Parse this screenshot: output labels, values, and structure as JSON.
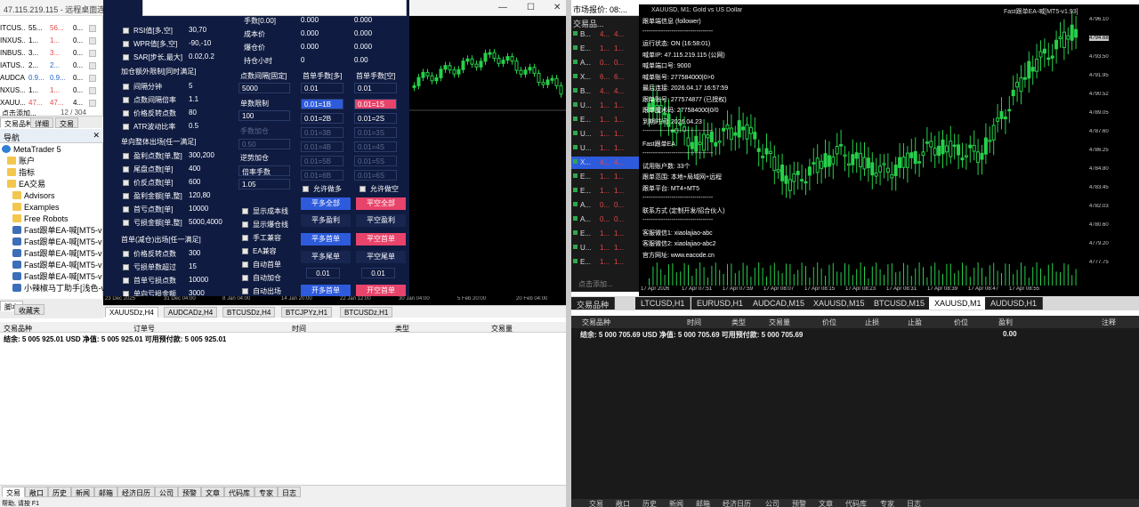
{
  "left_window": {
    "title": "47.115.219.115 - 远程桌面连接",
    "win_controls": [
      "—",
      "☐",
      "✕"
    ]
  },
  "market_watch": {
    "rows": [
      {
        "symbol": "ITCUS...",
        "bid": "55...",
        "ask": "56...",
        "delta": "0..."
      },
      {
        "symbol": "INXUS...",
        "bid": "1...",
        "ask": "1...",
        "delta": "0..."
      },
      {
        "symbol": "INBUS...",
        "bid": "3...",
        "ask": "3...",
        "delta": "0..."
      },
      {
        "symbol": "IATUS...",
        "bid": "2...",
        "ask": "2...",
        "delta": "0..."
      },
      {
        "symbol": "AUDCA...",
        "bid": "0.9...",
        "ask": "0.9...",
        "delta": "0..."
      },
      {
        "symbol": "NXUS...",
        "bid": "1...",
        "ask": "1...",
        "delta": "0..."
      },
      {
        "symbol": "XAUU...",
        "bid": "47...",
        "ask": "47...",
        "delta": "4..."
      }
    ],
    "footer": "点击添加...",
    "count": "12 / 304",
    "tabs": [
      "交易品种",
      "详细",
      "交易"
    ]
  },
  "navigator": {
    "header": "导航",
    "root": "MetaTrader 5",
    "items": [
      "账户",
      "指标",
      "EA交易",
      "Advisors",
      "Examples",
      "Free Robots",
      "Fast跟单EA-喊[MT5-v",
      "Fast跟单EA-喊[MT5-v",
      "Fast跟单EA-喊[MT5-v",
      "Fast跟单EA-喊[MT5-v",
      "Fast跟单EA-喊[MT5-v",
      "小辣椒马丁助手[浅色-v"
    ],
    "tabs": [
      "脚本",
      "收藏夹"
    ]
  },
  "ea_panel": {
    "top_rows": [
      {
        "label": "RSI值[多,空]",
        "value": "30,70"
      },
      {
        "label": "WPR值[多,空]",
        "value": "-90,-10"
      },
      {
        "label": "SAR[步长,最大]",
        "value": "0.02,0.2"
      }
    ],
    "section1": "加仓额外限制[同时满足]",
    "sec1_rows": [
      {
        "label": "间隔分钟",
        "value": "5"
      },
      {
        "label": "点数间隔倍率",
        "value": "1.1"
      },
      {
        "label": "价格反转点数",
        "value": "80"
      },
      {
        "label": "ATR波动比率",
        "value": "0.5"
      }
    ],
    "section2": "单向整体出场[任一满足]",
    "sec2_rows": [
      {
        "label": "盈利点数[单,整]",
        "value": "300,200"
      },
      {
        "label": "尾盘点数[单]",
        "value": "400"
      },
      {
        "label": "价反点数[单]",
        "value": "600"
      },
      {
        "label": "盈利金额[单,整]",
        "value": "120,80"
      },
      {
        "label": "首亏点数[单]",
        "value": "10000"
      },
      {
        "label": "亏损金额[单,整]",
        "value": "5000,4000"
      }
    ],
    "section3": "首单(减仓)出场[任一满足]",
    "sec3_rows": [
      {
        "label": "价格反转点数",
        "value": "300"
      },
      {
        "label": "亏损单数超过",
        "value": "15"
      },
      {
        "label": "首单亏损点数",
        "value": "10000"
      },
      {
        "label": "单向亏损金额",
        "value": "3000"
      }
    ],
    "mid_labels": [
      "手数[0.00]",
      "成本价",
      "爆仓价",
      "持仓小时"
    ],
    "mid_vals_a": [
      "0.000",
      "0.000",
      "0.000",
      "0"
    ],
    "mid_vals_b": [
      "0.000",
      "0.000",
      "0.000",
      "0.00"
    ],
    "interval_label": "点数间隔[固定]",
    "interval_value": "5000",
    "limit_label": "单数限制",
    "limit_value": "100",
    "lot_buy_label": "首单手数[多]",
    "lot_sell_label": "首单手数[空]",
    "lot_buy_value": "0.01",
    "lot_sell_value": "0.01",
    "buy_chain": [
      "0.01=1B",
      "0.01=2B",
      "0.01=3B",
      "0.01=4B",
      "0.01=5B",
      "0.01=6B"
    ],
    "sell_chain": [
      "0.01=1S",
      "0.01=2S",
      "0.01=3S",
      "0.01=4S",
      "0.01=5S",
      "0.01=6S"
    ],
    "mid_left_opts": [
      "手数加仓",
      "0.50",
      "逆势加仓",
      "倍率手数",
      "1.05"
    ],
    "allow_buy": "允许做多",
    "allow_sell": "允许做空",
    "checks": [
      "显示成本线",
      "显示爆仓线",
      "手工兼容",
      "EA兼容",
      "自动首单",
      "自动加仓",
      "自动出场"
    ],
    "buttons": {
      "close_all_buy": "平多全部",
      "close_all_sell": "平空全部",
      "close_buy_profit": "平多盈利",
      "close_sell_profit": "平空盈利",
      "close_buy_first": "平多首单",
      "close_sell_first": "平空首单",
      "close_buy_tail": "平多尾单",
      "close_sell_tail": "平空尾单",
      "open_buy": "开多首单",
      "open_sell": "开空首单"
    },
    "small_lots": [
      "0.01",
      "0.01"
    ]
  },
  "left_chart_axis": [
    "23 Dec 2025",
    "31 Dec 04:00",
    "8 Jan 04:00",
    "14 Jan 20:00",
    "22 Jan 12:00",
    "30 Jan 04:00",
    "5 Feb 20:00",
    "20 Feb 04:00"
  ],
  "left_chart_tabs": [
    "XAUUSDz,H4",
    "AUDCADz,H4",
    "BTCUSDz,H4",
    "BTCJPYz,H1",
    "BTCUSDz,H1"
  ],
  "left_terminal": {
    "headers": [
      "交易品种",
      "订单号",
      "时间",
      "类型",
      "交易量"
    ],
    "balance": "结余: 5 005 925.01 USD  净值: 5 005 925.01  可用预付款: 5 005 925.01",
    "tabs": [
      "交易",
      "敞口",
      "历史",
      "新闻",
      "邮箱",
      "经济日历",
      "公司",
      "预警",
      "文章",
      "代码库",
      "专家",
      "日志"
    ],
    "status": "帮助, 请按 F1"
  },
  "right_window": {
    "title": "市场报价: 08:...",
    "mw_header": "交易品...",
    "mw_rows": [
      {
        "symbol": "B...",
        "bid": "4...",
        "ask": "4..."
      },
      {
        "symbol": "E...",
        "bid": "1...",
        "ask": "1..."
      },
      {
        "symbol": "A...",
        "bid": "0...",
        "ask": "0..."
      },
      {
        "symbol": "X...",
        "bid": "6...",
        "ask": "6..."
      },
      {
        "symbol": "B...",
        "bid": "4...",
        "ask": "4..."
      },
      {
        "symbol": "U...",
        "bid": "1...",
        "ask": "1..."
      },
      {
        "symbol": "E...",
        "bid": "1...",
        "ask": "1..."
      },
      {
        "symbol": "U...",
        "bid": "1...",
        "ask": "1..."
      },
      {
        "symbol": "U...",
        "bid": "1...",
        "ask": "1..."
      },
      {
        "symbol": "X...",
        "bid": "4...",
        "ask": "4..."
      },
      {
        "symbol": "E...",
        "bid": "1...",
        "ask": "1..."
      },
      {
        "symbol": "E...",
        "bid": "1...",
        "ask": "1..."
      },
      {
        "symbol": "A...",
        "bid": "0...",
        "ask": "0..."
      },
      {
        "symbol": "A...",
        "bid": "0...",
        "ask": "0..."
      },
      {
        "symbol": "E...",
        "bid": "1...",
        "ask": "1..."
      },
      {
        "symbol": "U...",
        "bid": "1...",
        "ask": "1..."
      },
      {
        "symbol": "E...",
        "bid": "1...",
        "ask": "1..."
      }
    ],
    "mw_footer": "点击添加...",
    "mw_tab": "交易品种"
  },
  "right_chart": {
    "symbol_line": "XAUUSD, M1:  Gold vs US Dollar",
    "ea_badge": "Fast跟单EA-喊[MT5-v1.93]",
    "overlay": [
      "跟单端信息 (follower)",
      "----------------------------------",
      "运行状态:   ON  (16:58:01)",
      "喊单IP:   47.115.219.115 (公网)",
      "喊单端口号:   9000",
      "喊单账号:   277584000|0>0",
      "最后连接:   2026.04.17 16:57:59",
      "跟单账号:   277574877 (已授权)",
      "跟单魔术码:   277584000|0/0",
      "到期时间:   2026.04.23",
      "----------------------------------",
      "Fast跟单EA",
      "----------------------------------",
      "试用账户数:   33个",
      "跟单范围:  本地+局域网+远程",
      "跟单平台:   MT4+MT5",
      "----------------------------------",
      "联系方式   (定制开发/招合伙人)",
      "----------------------------------",
      "客服微信1:   xiaolajiao-abc",
      "客服微信2:   xiaolajiao-abc2",
      "官方网址:   www.eacode.cn"
    ],
    "price_labels": [
      "4796.10",
      "4794.68",
      "4793.50",
      "4791.95",
      "4790.52",
      "4789.05",
      "4787.60",
      "4786.25",
      "4784.80",
      "4783.45",
      "4782.03",
      "4780.60",
      "4779.20",
      "4777.75"
    ],
    "time_labels": [
      "17 Apr 2026",
      "17 Apr 07:51",
      "17 Apr 07:59",
      "17 Apr 08:07",
      "17 Apr 08:15",
      "17 Apr 08:23",
      "17 Apr 08:31",
      "17 Apr 08:39",
      "17 Apr 08:47",
      "17 Apr 08:55"
    ],
    "tabs": [
      "LTCUSD,H1",
      "EURUSD,H1",
      "AUDCAD,M15",
      "XAUUSD,M15",
      "BTCUSD,M15",
      "XAUUSD,M1",
      "AUDUSD,H1"
    ],
    "left_tab": "交易品种"
  },
  "right_terminal": {
    "headers": [
      "交易品种",
      "时间",
      "类型",
      "交易量",
      "价位",
      "止损",
      "止盈",
      "价位",
      "盈利",
      "注释"
    ],
    "balance": "结余: 5 000 705.69 USD  净值: 5 000 705.69  可用预付款: 5 000 705.69",
    "profit": "0.00",
    "tabs": [
      "交易",
      "敞口",
      "历史",
      "新闻",
      "邮箱",
      "经济日历",
      "公司",
      "预警",
      "文章",
      "代码库",
      "专家",
      "日志"
    ]
  },
  "colors": {
    "panel_bg": "#0f1b40",
    "btn_blue": "#2e5bdc",
    "btn_red": "#e8436a",
    "candle_up": "#26d04a",
    "chart_bg": "#000000"
  },
  "chart_data": {
    "type": "line",
    "title": "XAUUSD, M1:  Gold vs US Dollar",
    "ylim": [
      4777.75,
      4796.1
    ],
    "x": [
      "17 Apr 2026",
      "17 Apr 07:51",
      "17 Apr 07:59",
      "17 Apr 08:07",
      "17 Apr 08:15",
      "17 Apr 08:23",
      "17 Apr 08:31",
      "17 Apr 08:39",
      "17 Apr 08:47",
      "17 Apr 08:55"
    ],
    "series": [
      {
        "values": [
          4789.6,
          4786.6,
          4787.9,
          4783.8,
          4786.1,
          4784.6,
          4786.5,
          4785.9,
          4792.0,
          4794.9
        ]
      }
    ]
  }
}
